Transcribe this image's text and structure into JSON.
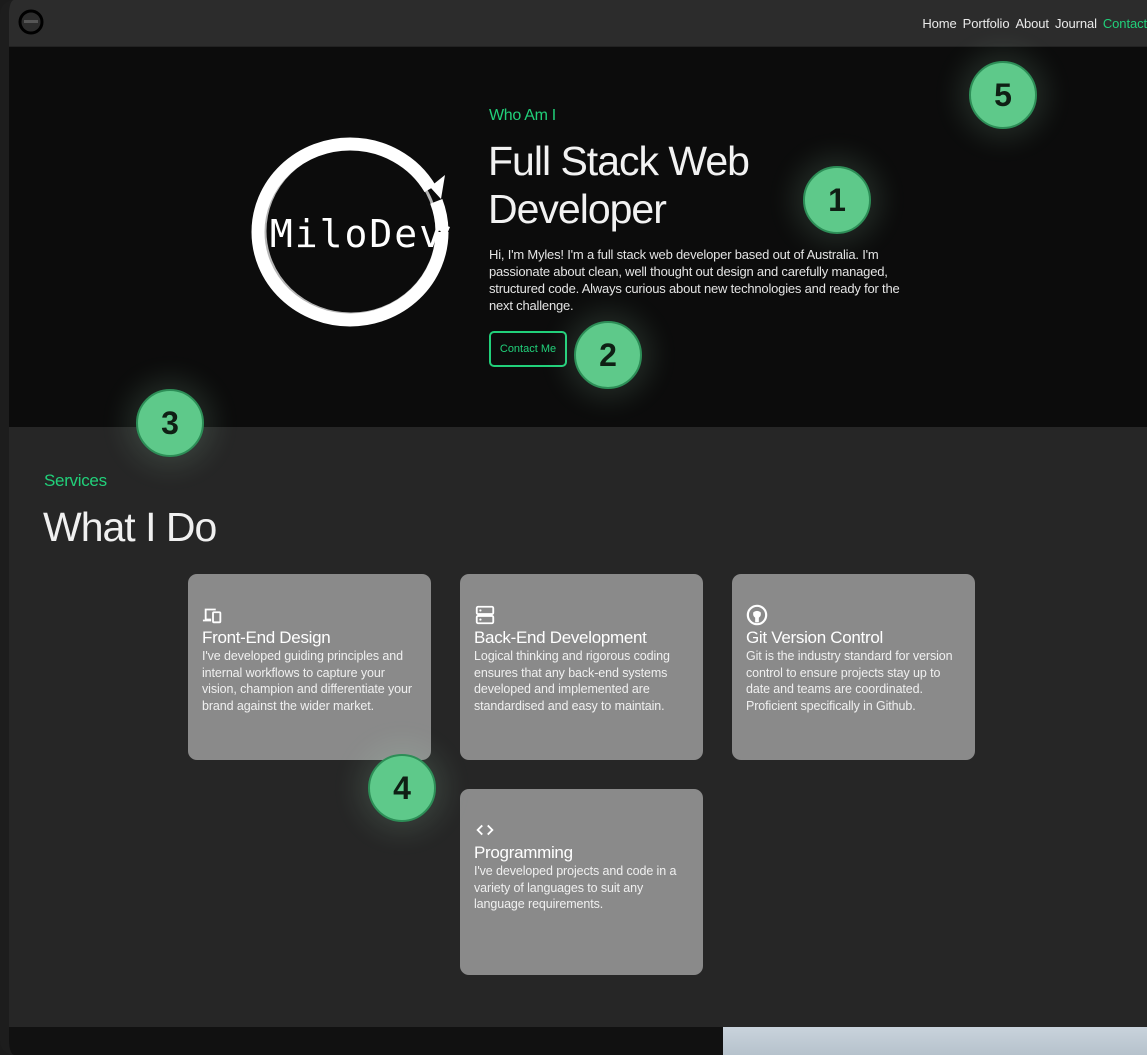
{
  "nav": {
    "logo_icon": "milodev-logo-icon",
    "links": [
      {
        "label": "Home"
      },
      {
        "label": "Portfolio"
      },
      {
        "label": "About"
      },
      {
        "label": "Journal"
      },
      {
        "label": "Contact",
        "active": true
      }
    ]
  },
  "hero": {
    "logo_text": "MiloDev",
    "eyebrow": "Who Am I",
    "title": "Full Stack Web Developer",
    "bio": "Hi, I'm Myles! I'm a full stack web developer based out of Australia. I'm passionate about clean, well thought out design and carefully managed, structured code. Always curious about new technologies and ready for the next challenge.",
    "cta_label": "Contact Me"
  },
  "services": {
    "eyebrow": "Services",
    "title": "What I Do",
    "cards": [
      {
        "icon": "devices-icon",
        "title": "Front-End Design",
        "text": "I've developed guiding principles and internal workflows to capture your vision, champion and differentiate your brand against the wider market."
      },
      {
        "icon": "server-icon",
        "title": "Back-End Development",
        "text": "Logical thinking and rigorous coding ensures that any back-end systems developed and implemented are standardised and easy to maintain."
      },
      {
        "icon": "github-icon",
        "title": "Git Version Control",
        "text": "Git is the industry standard for version control to ensure projects stay up to date and teams are coordinated. Proficient specifically in Github."
      },
      {
        "icon": "code-icon",
        "title": "Programming",
        "text": "I've developed projects and code in a variety of languages to suit any language requirements."
      }
    ]
  },
  "annotations": [
    "1",
    "2",
    "3",
    "4",
    "5"
  ],
  "colors": {
    "accent": "#21d07a",
    "hero_bg": "#0c0c0c",
    "section_bg": "#262626",
    "card_bg": "#8a8a8a",
    "badge": "#5ec98a"
  }
}
